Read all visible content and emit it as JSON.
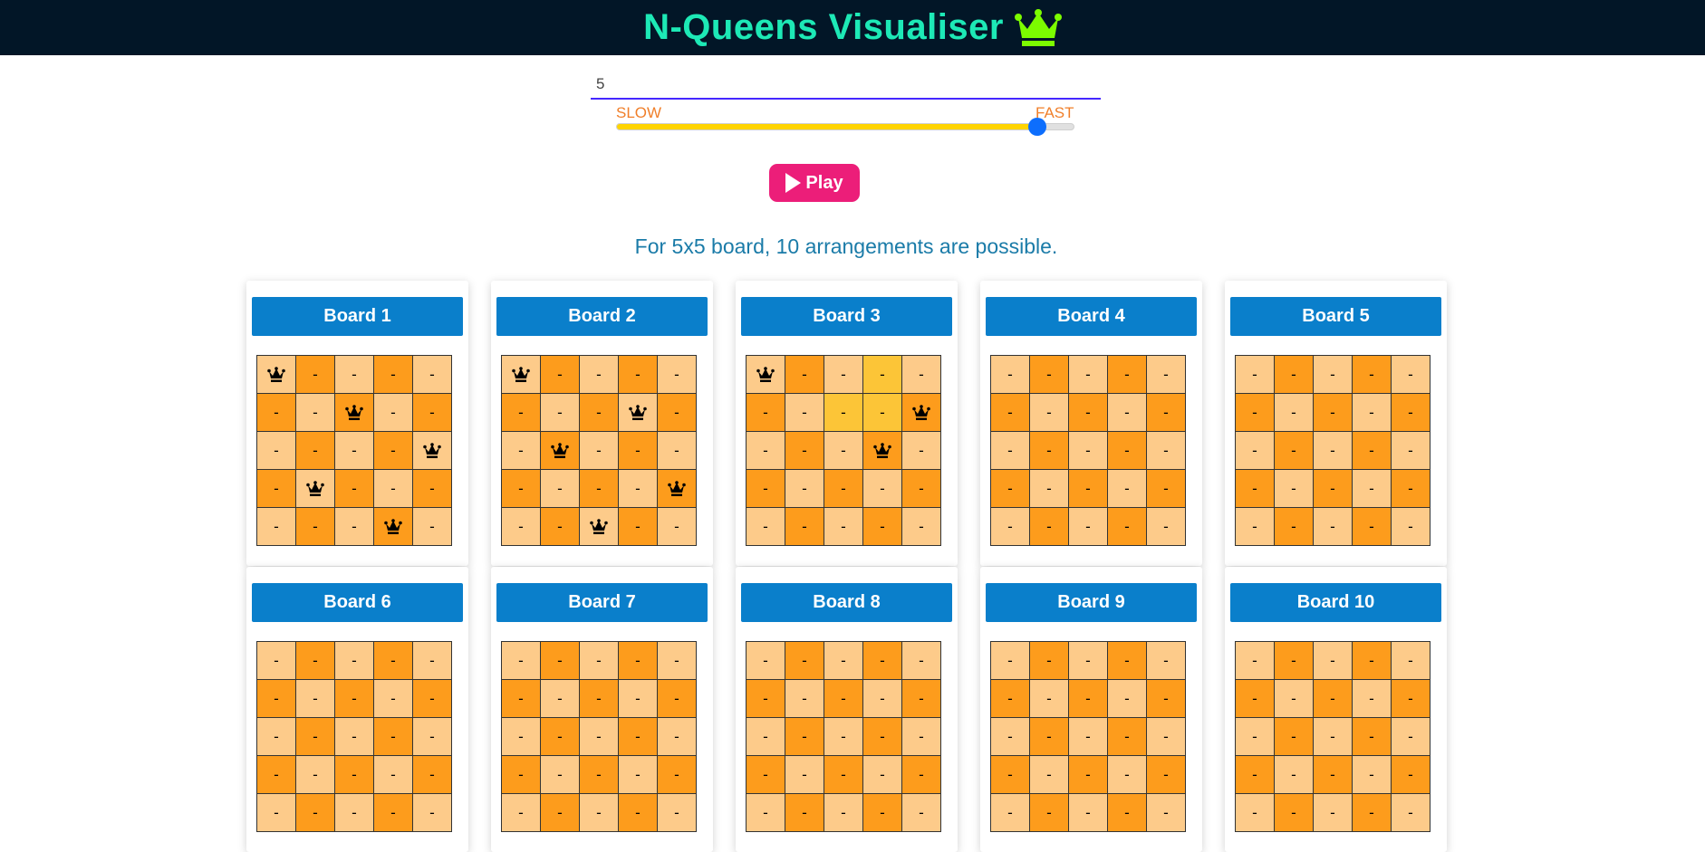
{
  "header": {
    "title": "N-Queens Visualiser",
    "icon": "crown-icon",
    "icon_color": "#7cfc00"
  },
  "controls": {
    "n_value": "5",
    "speed": {
      "slow_label": "SLOW",
      "fast_label": "FAST",
      "value_fraction": 0.92
    },
    "play_label": "Play"
  },
  "info_text": "For 5x5 board, 10 arrangements are possible.",
  "colors": {
    "light": "#fdcb8a",
    "dark": "#fd9c1c",
    "highlight": "#fcc537",
    "header_blue": "#0a7fcb",
    "play": "#ec1e79"
  },
  "boards": [
    {
      "title": "Board 1",
      "queens": [
        [
          0,
          0
        ],
        [
          1,
          2
        ],
        [
          2,
          4
        ],
        [
          3,
          1
        ],
        [
          4,
          3
        ]
      ],
      "highlight": []
    },
    {
      "title": "Board 2",
      "queens": [
        [
          0,
          0
        ],
        [
          1,
          3
        ],
        [
          2,
          1
        ],
        [
          3,
          4
        ],
        [
          4,
          2
        ]
      ],
      "highlight": []
    },
    {
      "title": "Board 3",
      "queens": [
        [
          0,
          0
        ],
        [
          1,
          4
        ],
        [
          2,
          3
        ]
      ],
      "highlight": [
        [
          0,
          3
        ],
        [
          1,
          2
        ],
        [
          1,
          3
        ]
      ]
    },
    {
      "title": "Board 4",
      "queens": [],
      "highlight": []
    },
    {
      "title": "Board 5",
      "queens": [],
      "highlight": []
    },
    {
      "title": "Board 6",
      "queens": [],
      "highlight": []
    },
    {
      "title": "Board 7",
      "queens": [],
      "highlight": []
    },
    {
      "title": "Board 8",
      "queens": [],
      "highlight": []
    },
    {
      "title": "Board 9",
      "queens": [],
      "highlight": []
    },
    {
      "title": "Board 10",
      "queens": [],
      "highlight": []
    }
  ],
  "empty_cell_text": "-",
  "board_size": 5
}
